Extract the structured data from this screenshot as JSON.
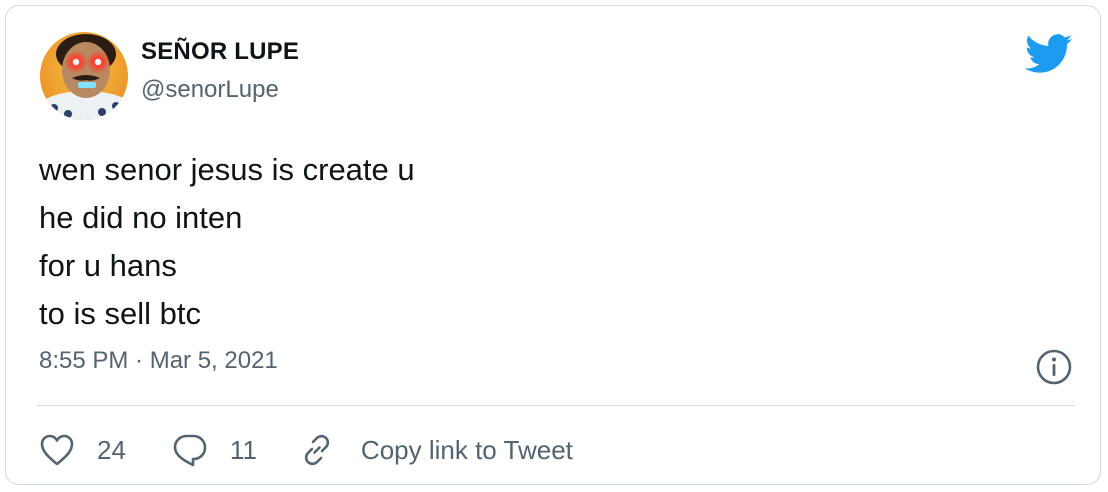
{
  "tweet": {
    "author": {
      "display_name": "SEÑOR LUPE",
      "handle": "@senorLupe",
      "avatar_icon": "laser-eyes-avatar"
    },
    "text_lines": [
      "wen senor jesus is create u",
      "he did no inten",
      "for u hans",
      "to is sell btc"
    ],
    "timestamp": "8:55 PM · Mar 5, 2021",
    "actions": {
      "like_count": "24",
      "reply_count": "11",
      "copy_link_label": "Copy link to Tweet"
    }
  },
  "colors": {
    "twitter_blue": "#1d9bf0",
    "text_primary": "#0f1419",
    "text_secondary": "#536471",
    "border": "#cfd9de"
  },
  "icons": {
    "brand": "twitter-bird-icon",
    "info": "info-icon",
    "like": "heart-icon",
    "reply": "reply-bubble-icon",
    "copy_link": "link-icon"
  }
}
